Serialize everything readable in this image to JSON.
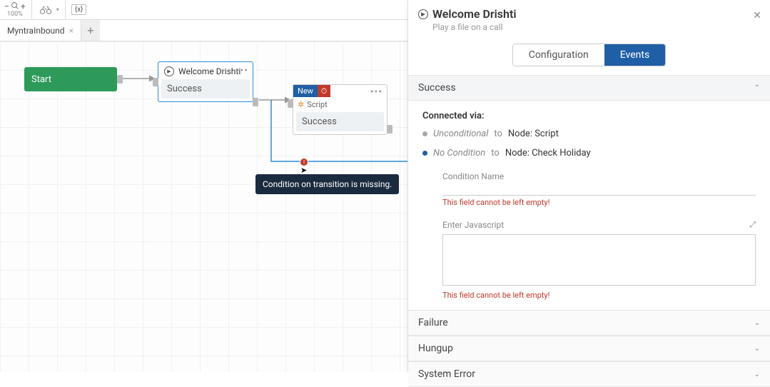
{
  "toolbar": {
    "zoom_label": "100%",
    "var_chip": "{x}"
  },
  "tabs": {
    "active": "MyntraInbound"
  },
  "nodes": {
    "start": "Start",
    "welcome_title": "Welcome Drishti",
    "welcome_slot": "Success",
    "script_new": "New",
    "script_label": "Script",
    "script_slot": "Success"
  },
  "tooltip": "Condition on transition is missing.",
  "panel": {
    "title": "Welcome Drishti",
    "subtitle": "Play a file on a call",
    "tab_config": "Configuration",
    "tab_events": "Events",
    "accordions": {
      "success": "Success",
      "failure": "Failure",
      "hungup": "Hungup",
      "system_error": "System Error"
    },
    "connected_via": "Connected via:",
    "conn1_cond": "Unconditional",
    "conn1_to": "to",
    "conn1_node": "Node: Script",
    "conn2_cond": "No Condition",
    "conn2_to": "to",
    "conn2_node": "Node: Check Holiday",
    "field_condition_label": "Condition Name",
    "field_js_label": "Enter Javascript",
    "err_empty": "This field cannot be left empty!"
  }
}
